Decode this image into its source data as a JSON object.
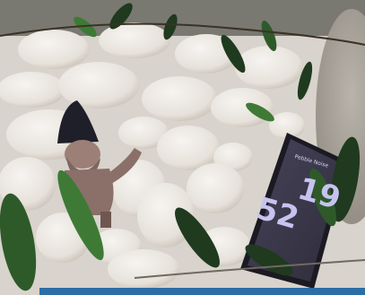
{
  "photo": {
    "subject": "garden gnome among white pebbles and olive leaves beside a smartphone"
  },
  "phone": {
    "header": "Pebble Noise",
    "time_hours": "19",
    "time_minutes": "52"
  },
  "colors": {
    "pebble": "#ece9e4",
    "pebble_shadow": "#cfc9c1",
    "leaf_dark": "#1f3a1f",
    "leaf_light": "#3e7a35",
    "phone_screen": "#3b3847",
    "phone_clock": "#c7c3f0",
    "gnome_body": "#8a7068",
    "gnome_hat": "#1f1f2a",
    "bottom_bar": "#2b6ea6"
  }
}
